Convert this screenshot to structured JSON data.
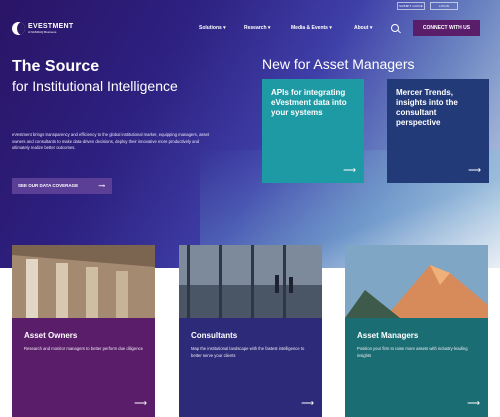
{
  "topbar": {
    "submit_guide": "SUBMIT GUIDE",
    "login": "LOGIN"
  },
  "logo": {
    "name": "EVESTMENT",
    "tagline": "A NASDAQ Business"
  },
  "nav": {
    "items": [
      "Solutions ▾",
      "Research ▾",
      "Media & Events ▾",
      "About ▾"
    ]
  },
  "connect_label": "CONNECT WITH US",
  "hero": {
    "title": "The Source",
    "subtitle": "for Institutional Intelligence",
    "description": "eVestment brings transparency and efficiency to the global institutional market, equipping managers, asset owners and consultants to make data-driven decisions, deploy their innovative more productively and ultimately realize better outcomes.",
    "cta": "SEE OUR DATA COVERAGE"
  },
  "new_section": {
    "heading": "New for Asset Managers",
    "cards": [
      {
        "title": "APIs for integrating eVestment data into your systems"
      },
      {
        "title": "Mercer Trends, insights into the consultant perspective"
      }
    ]
  },
  "tiles": [
    {
      "title": "Asset Owners",
      "text": "Research and monitor managers to better perform due diligence"
    },
    {
      "title": "Consultants",
      "text": "Map the institutional landscape with the fastest intelligence to better serve your clients"
    },
    {
      "title": "Asset Managers",
      "text": "Position your firm to raise more assets with industry-leading insights"
    }
  ],
  "colors": {
    "hero_dark": "#2a1566",
    "card_teal": "#1e9aa4",
    "card_navy": "#223a78",
    "tile_purple": "#5a1d6a",
    "tile_indigo": "#2d2a7a",
    "tile_teal": "#1a6e73"
  }
}
